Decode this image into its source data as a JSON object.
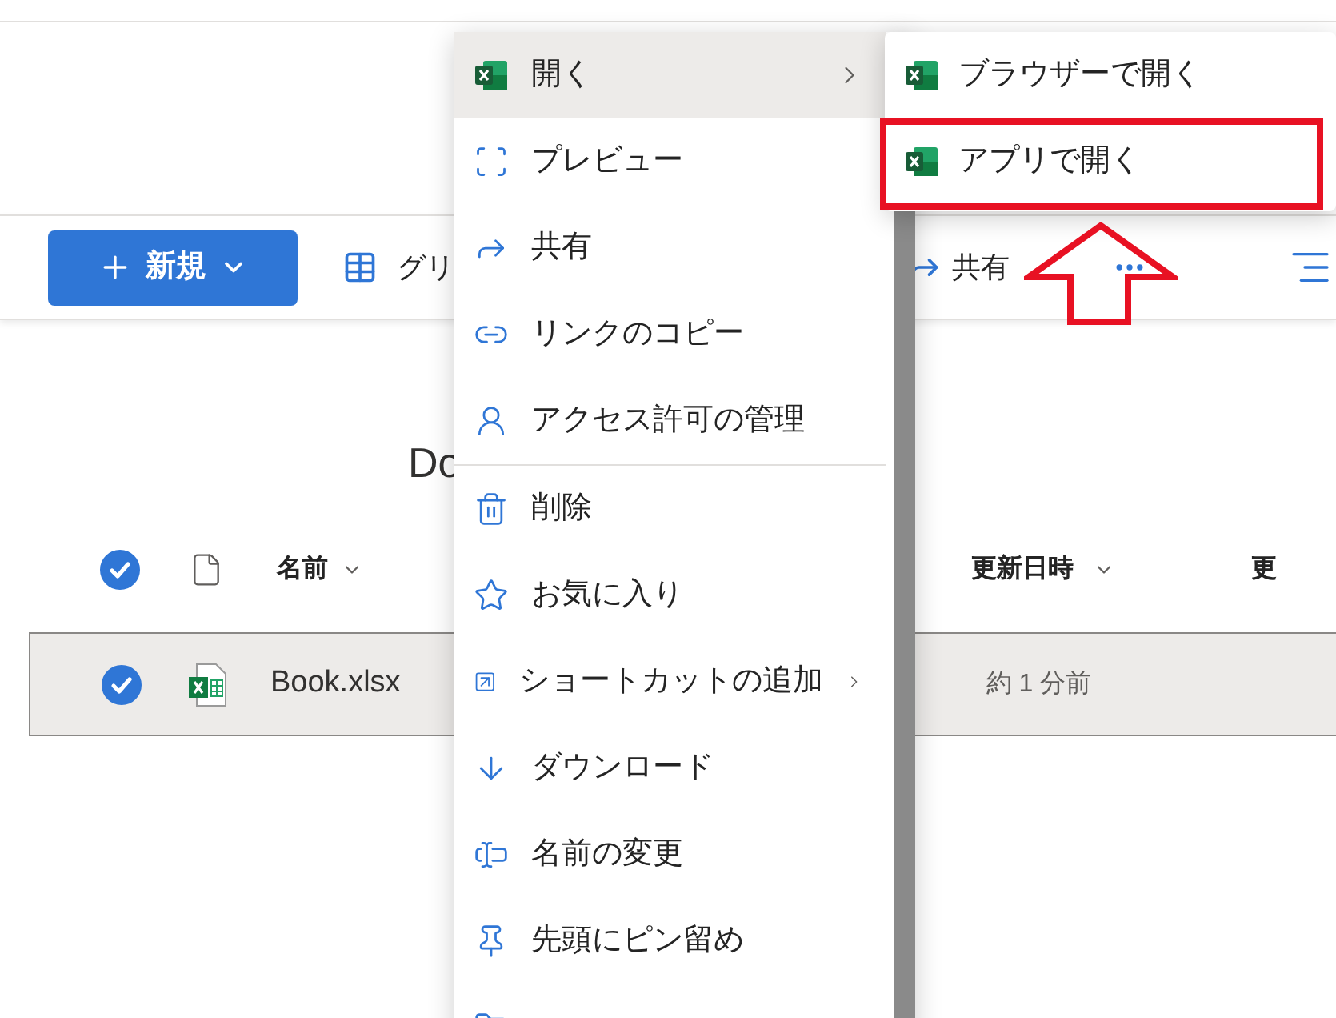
{
  "toolbar": {
    "new_button": {
      "label": "新規"
    },
    "view_button": {
      "label": "グリ"
    },
    "share_button": {
      "label": "共有"
    }
  },
  "heading": "Do",
  "table": {
    "header_checked": true,
    "columns": [
      "名前",
      "更新日時",
      "更"
    ],
    "rows": [
      {
        "name": "Book.xlsx",
        "modified": "約 1 分前",
        "selected": true
      }
    ]
  },
  "context_menu": {
    "items": [
      {
        "kind": "item",
        "label": "開く",
        "highlighted": true,
        "has_submenu": true
      },
      {
        "kind": "item",
        "label": "プレビュー",
        "highlighted": false,
        "has_submenu": false
      },
      {
        "kind": "item",
        "label": "共有",
        "highlighted": false,
        "has_submenu": false
      },
      {
        "kind": "item",
        "label": "リンクのコピー",
        "highlighted": false,
        "has_submenu": false
      },
      {
        "kind": "item",
        "label": "アクセス許可の管理",
        "highlighted": false,
        "has_submenu": false
      },
      {
        "kind": "separator"
      },
      {
        "kind": "item",
        "label": "削除",
        "highlighted": false,
        "has_submenu": false
      },
      {
        "kind": "item",
        "label": "お気に入り",
        "highlighted": false,
        "has_submenu": false
      },
      {
        "kind": "item",
        "label": "ショートカットの追加",
        "highlighted": false,
        "has_submenu": true
      },
      {
        "kind": "item",
        "label": "ダウンロード",
        "highlighted": false,
        "has_submenu": false
      },
      {
        "kind": "item",
        "label": "名前の変更",
        "highlighted": false,
        "has_submenu": false
      },
      {
        "kind": "item",
        "label": "先頭にピン留め",
        "highlighted": false,
        "has_submenu": false
      }
    ]
  },
  "submenu": {
    "items": [
      {
        "label": "ブラウザーで開く",
        "highlighted": false
      },
      {
        "label": "アプリで開く",
        "highlighted": true
      }
    ]
  }
}
